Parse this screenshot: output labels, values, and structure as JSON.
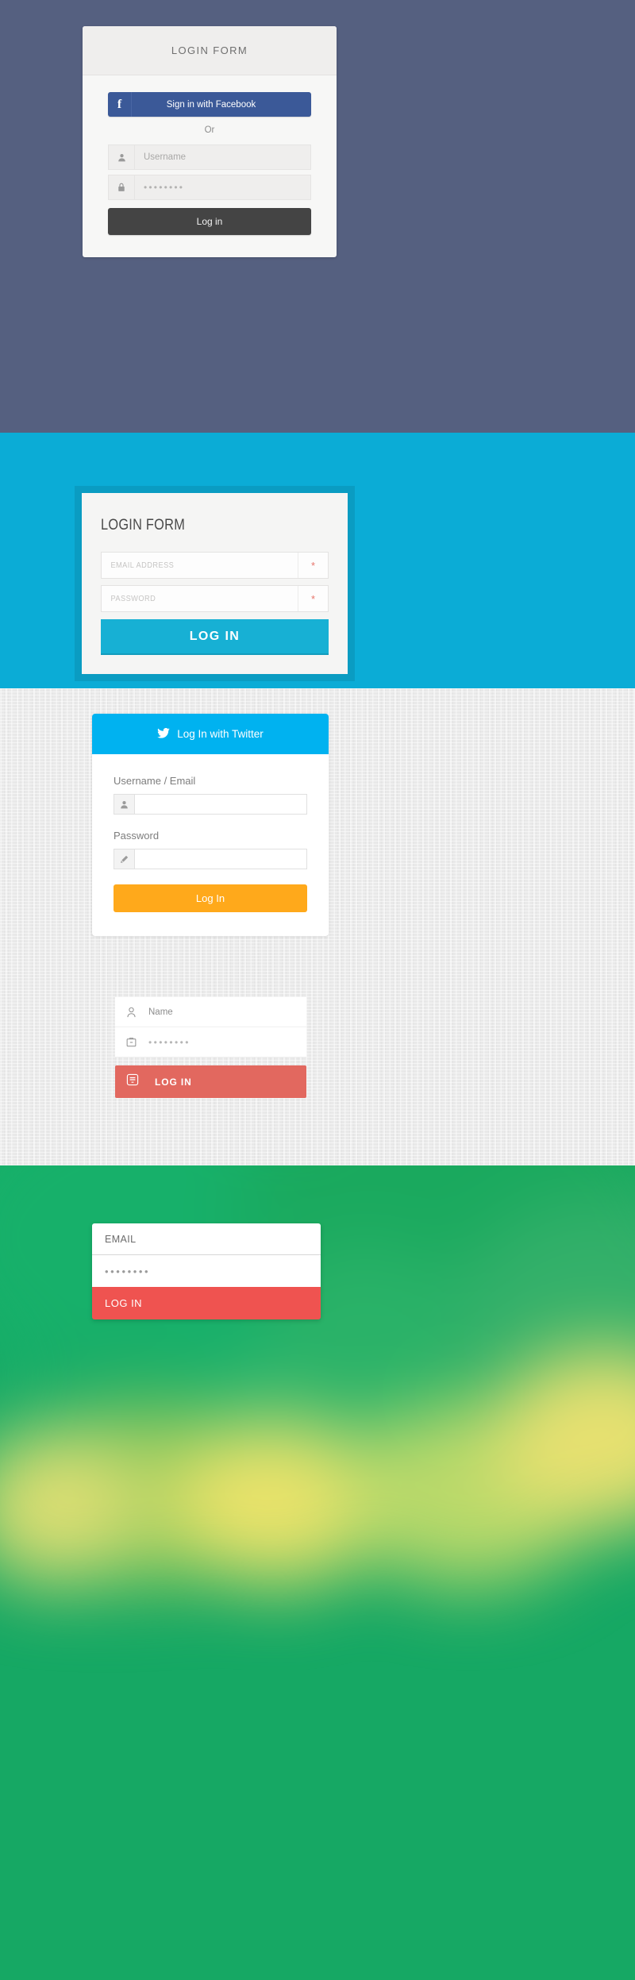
{
  "section_facebook": {
    "background_color": "#556080",
    "card_title": "LOGIN FORM",
    "facebook_button": {
      "icon": "facebook-f-icon",
      "glyph": "f",
      "label": "Sign in with Facebook",
      "color": "#3b5998"
    },
    "divider_text": "Or",
    "username_field": {
      "icon": "user-icon",
      "placeholder": "Username",
      "value": ""
    },
    "password_field": {
      "icon": "lock-icon",
      "value": "••••••••"
    },
    "submit_label": "Log in",
    "submit_color": "#444444"
  },
  "section_cyan": {
    "background_color": "#0bacd6",
    "title": "LOGIN FORM",
    "email_field": {
      "placeholder": "EMAIL ADDRESS",
      "value": "",
      "required_marker": "*"
    },
    "password_field": {
      "placeholder": "PASSWORD",
      "value": "",
      "required_marker": "*"
    },
    "submit_label": "LOG IN",
    "submit_color": "#17b0d4",
    "required_marker_color": "#e7756c"
  },
  "section_twitter": {
    "background_color": "#e9e9e9",
    "twitter_button": {
      "icon": "twitter-bird-icon",
      "label": "Log In with Twitter",
      "color": "#00b2f0"
    },
    "username_label": "Username / Email",
    "username_field": {
      "icon": "user-icon",
      "value": ""
    },
    "password_label": "Password",
    "password_field": {
      "icon": "pencil-icon",
      "value": ""
    },
    "submit_label": "Log In",
    "submit_color": "#ffa91b"
  },
  "section_minimal_red": {
    "name_field": {
      "icon": "user-outline-icon",
      "placeholder": "Name",
      "value": ""
    },
    "password_field": {
      "icon": "card-outline-icon",
      "value": "••••••••"
    },
    "submit_icon": "enter-box-icon",
    "submit_label": "LOG IN",
    "submit_color": "#e2685f"
  },
  "section_green": {
    "background_color": "#16a864",
    "email_field": {
      "placeholder": "EMAIL",
      "value": "EMAIL"
    },
    "password_field": {
      "value": "••••••••"
    },
    "submit_label": "LOG IN",
    "submit_color": "#ef5350"
  }
}
